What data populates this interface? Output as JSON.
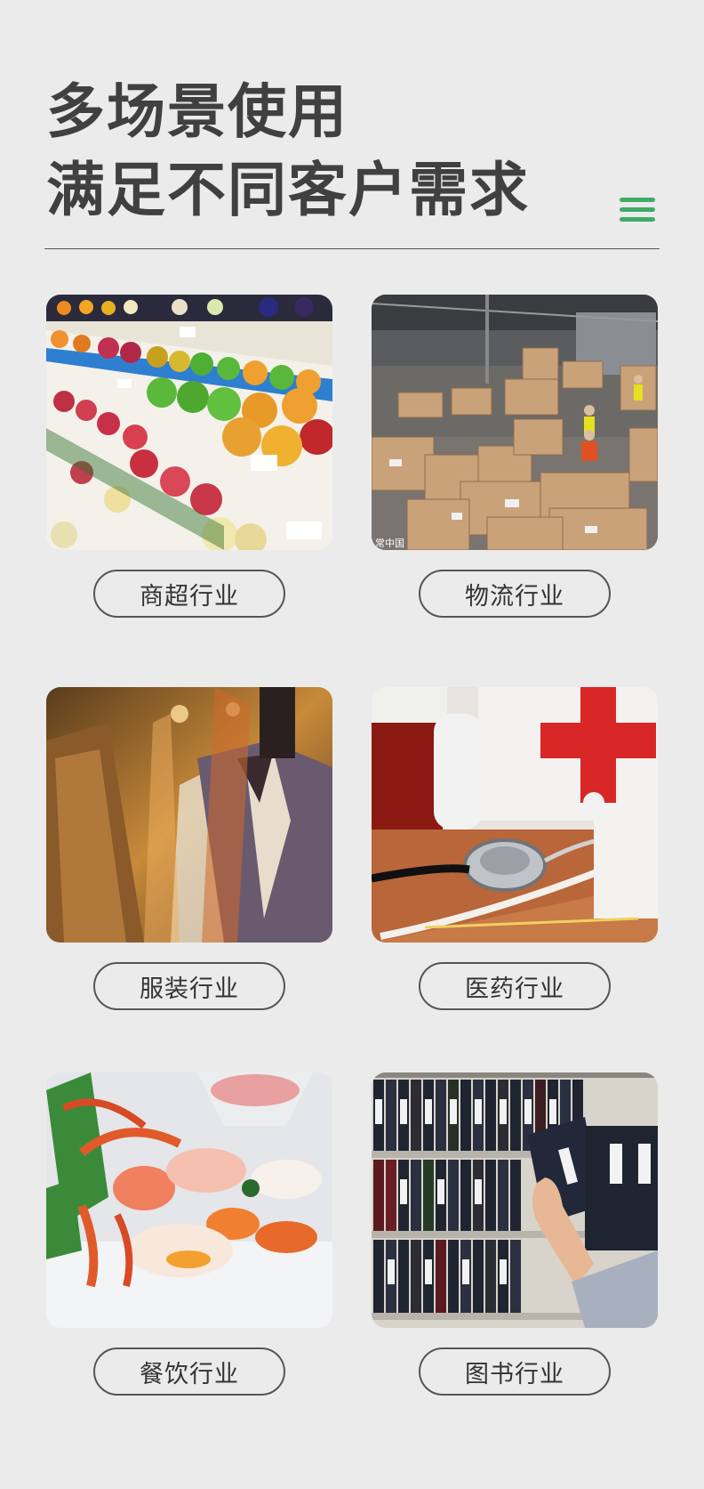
{
  "header": {
    "title_line1": "多场景使用",
    "title_line2": "满足不同客户需求",
    "menu_icon": "menu-icon",
    "accent_color": "#3fab68"
  },
  "industries": [
    {
      "label": "商超行业",
      "image": "supermarket-fruit-shelves"
    },
    {
      "label": "物流行业",
      "image": "warehouse-boxes"
    },
    {
      "label": "服装行业",
      "image": "clothing-store-suits"
    },
    {
      "label": "医药行业",
      "image": "medical-kit-stethoscope"
    },
    {
      "label": "餐饮行业",
      "image": "sashimi-seafood-platter"
    },
    {
      "label": "图书行业",
      "image": "library-file-binders"
    }
  ],
  "watermark": "常中国"
}
